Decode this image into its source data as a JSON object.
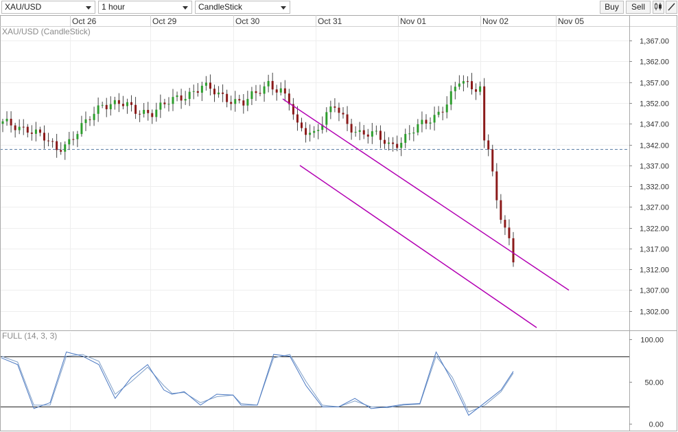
{
  "toolbar": {
    "symbol": "XAU/USD",
    "timeframe": "1 hour",
    "chart_style": "CandleStick",
    "buy_label": "Buy",
    "sell_label": "Sell"
  },
  "price_panel": {
    "overlay_label": "XAU/USD (CandleStick)"
  },
  "stoch_panel": {
    "overlay_label": "FULL (14, 3, 3)"
  },
  "colors": {
    "up_candle": "#2e9e2e",
    "down_candle": "#8b1a1a",
    "wick": "#444444",
    "channel": "#b300b3",
    "reference_line": "#5b7fa6",
    "stoch_k": "#4a78c2",
    "stoch_d": "#7f9fc8"
  },
  "chart_data": [
    {
      "type": "candlestick",
      "title": "XAU/USD (CandleStick)",
      "x_labels": [
        "Oct 26",
        "Oct 29",
        "Oct 30",
        "Oct 31",
        "Nov 01",
        "Nov 02",
        "Nov 05"
      ],
      "ylim": [
        1297.5,
        1370.5
      ],
      "y_ticks": [
        "1,367.00",
        "1,362.00",
        "1,357.00",
        "1,352.00",
        "1,347.00",
        "1,342.00",
        "1,337.00",
        "1,332.00",
        "1,327.00",
        "1,322.00",
        "1,317.00",
        "1,312.00",
        "1,307.00",
        "1,302.00"
      ],
      "y_tick_values": [
        1367,
        1362,
        1357,
        1352,
        1347,
        1342,
        1337,
        1332,
        1327,
        1322,
        1317,
        1312,
        1307,
        1302
      ],
      "reference_line": 1341,
      "candle_count": 124,
      "key_closes": [
        [
          0,
          1347
        ],
        [
          6,
          1346
        ],
        [
          9,
          1344
        ],
        [
          13,
          1341
        ],
        [
          16,
          1343
        ],
        [
          20,
          1347
        ],
        [
          24,
          1352
        ],
        [
          28,
          1352
        ],
        [
          32,
          1350
        ],
        [
          36,
          1350
        ],
        [
          40,
          1352
        ],
        [
          44,
          1354
        ],
        [
          48,
          1356
        ],
        [
          52,
          1354
        ],
        [
          55,
          1353
        ],
        [
          58,
          1352
        ],
        [
          61,
          1354
        ],
        [
          64,
          1357
        ],
        [
          67,
          1355
        ],
        [
          69,
          1352
        ],
        [
          71,
          1346
        ],
        [
          75,
          1345
        ],
        [
          78,
          1349
        ],
        [
          80,
          1351
        ],
        [
          83,
          1347
        ],
        [
          86,
          1345
        ],
        [
          90,
          1344
        ],
        [
          93,
          1342
        ],
        [
          96,
          1343
        ],
        [
          100,
          1346
        ],
        [
          104,
          1349
        ],
        [
          107,
          1352
        ],
        [
          110,
          1357
        ],
        [
          113,
          1356
        ],
        [
          115,
          1356
        ],
        [
          116,
          1343
        ],
        [
          120,
          1341
        ],
        [
          123,
          1339
        ]
      ],
      "channel_upper": {
        "start": [
          412,
          1353
        ],
        "end": [
          829,
          1307
        ]
      },
      "channel_lower": {
        "start": [
          437,
          1337
        ],
        "end": [
          782,
          1298
        ]
      }
    },
    {
      "type": "line",
      "title": "FULL (14, 3, 3)",
      "ylim": [
        0,
        100
      ],
      "y_ticks": [
        "100.00",
        "50.00",
        "0.00"
      ],
      "y_tick_values": [
        100,
        50,
        0
      ],
      "levels": [
        80,
        20
      ],
      "series": [
        {
          "name": "%K",
          "x": [
            0,
            8,
            16,
            24,
            32,
            40,
            48,
            56,
            64,
            72,
            80,
            84,
            90,
            98,
            106,
            114,
            118,
            126,
            134,
            142,
            150,
            158,
            166,
            174,
            182,
            190,
            198,
            206,
            214,
            222,
            230,
            238,
            246,
            252
          ],
          "values": [
            78,
            70,
            18,
            25,
            85,
            80,
            70,
            30,
            55,
            70,
            40,
            35,
            38,
            22,
            35,
            34,
            22,
            22,
            82,
            80,
            45,
            20,
            20,
            30,
            18,
            20,
            23,
            24,
            85,
            50,
            10,
            25,
            40,
            62
          ]
        },
        {
          "name": "%D",
          "x": [
            0,
            8,
            16,
            24,
            32,
            40,
            48,
            56,
            64,
            72,
            80,
            84,
            90,
            98,
            106,
            114,
            118,
            126,
            134,
            142,
            150,
            158,
            166,
            174,
            182,
            190,
            198,
            206,
            214,
            222,
            230,
            238,
            246,
            252
          ],
          "values": [
            80,
            73,
            22,
            22,
            80,
            82,
            74,
            35,
            50,
            67,
            45,
            36,
            37,
            25,
            32,
            34,
            24,
            22,
            78,
            82,
            50,
            22,
            20,
            27,
            20,
            19,
            22,
            23,
            80,
            55,
            14,
            22,
            38,
            60
          ]
        }
      ]
    }
  ]
}
